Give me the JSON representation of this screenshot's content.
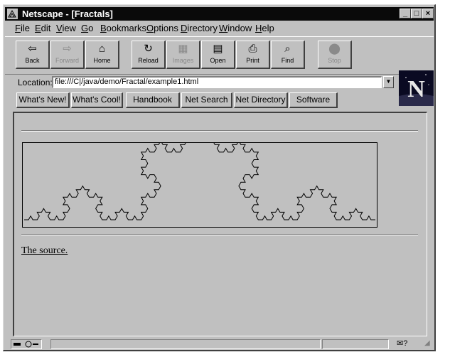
{
  "window": {
    "title": "Netscape - [Fractals]"
  },
  "title_buttons": {
    "minimize": "_",
    "maximize": "□",
    "close": "×"
  },
  "menu": [
    {
      "pre": "",
      "u": "F",
      "post": "ile"
    },
    {
      "pre": "",
      "u": "E",
      "post": "dit"
    },
    {
      "pre": "",
      "u": "V",
      "post": "iew"
    },
    {
      "pre": "",
      "u": "G",
      "post": "o"
    },
    {
      "pre": "",
      "u": "B",
      "post": "ookmarks"
    },
    {
      "pre": "",
      "u": "O",
      "post": "ptions"
    },
    {
      "pre": "",
      "u": "D",
      "post": "irectory"
    },
    {
      "pre": "",
      "u": "W",
      "post": "indow"
    },
    {
      "pre": "",
      "u": "H",
      "post": "elp"
    }
  ],
  "toolbar": {
    "back": "Back",
    "forward": "Forward",
    "home": "Home",
    "reload": "Reload",
    "images": "Images",
    "open": "Open",
    "print": "Print",
    "find": "Find",
    "stop": "Stop"
  },
  "location": {
    "label": "Location:",
    "url": "file:///C|/java/demo/Fractal/example1.html"
  },
  "directory_buttons": [
    "What's New!",
    "What's Cool!",
    "Handbook",
    "Net Search",
    "Net Directory",
    "Software"
  ],
  "logo": {
    "letter": "N"
  },
  "page": {
    "link_text": "The source."
  },
  "fractal": {
    "type": "Koch curve",
    "iterations": 4,
    "color": "#000000"
  },
  "icons": {
    "back": "left-arrow-icon",
    "forward": "right-arrow-icon",
    "home": "house-icon",
    "reload": "reload-icon",
    "images": "images-icon",
    "open": "open-icon",
    "print": "printer-icon",
    "find": "binoculars-icon",
    "stop": "stop-icon"
  }
}
